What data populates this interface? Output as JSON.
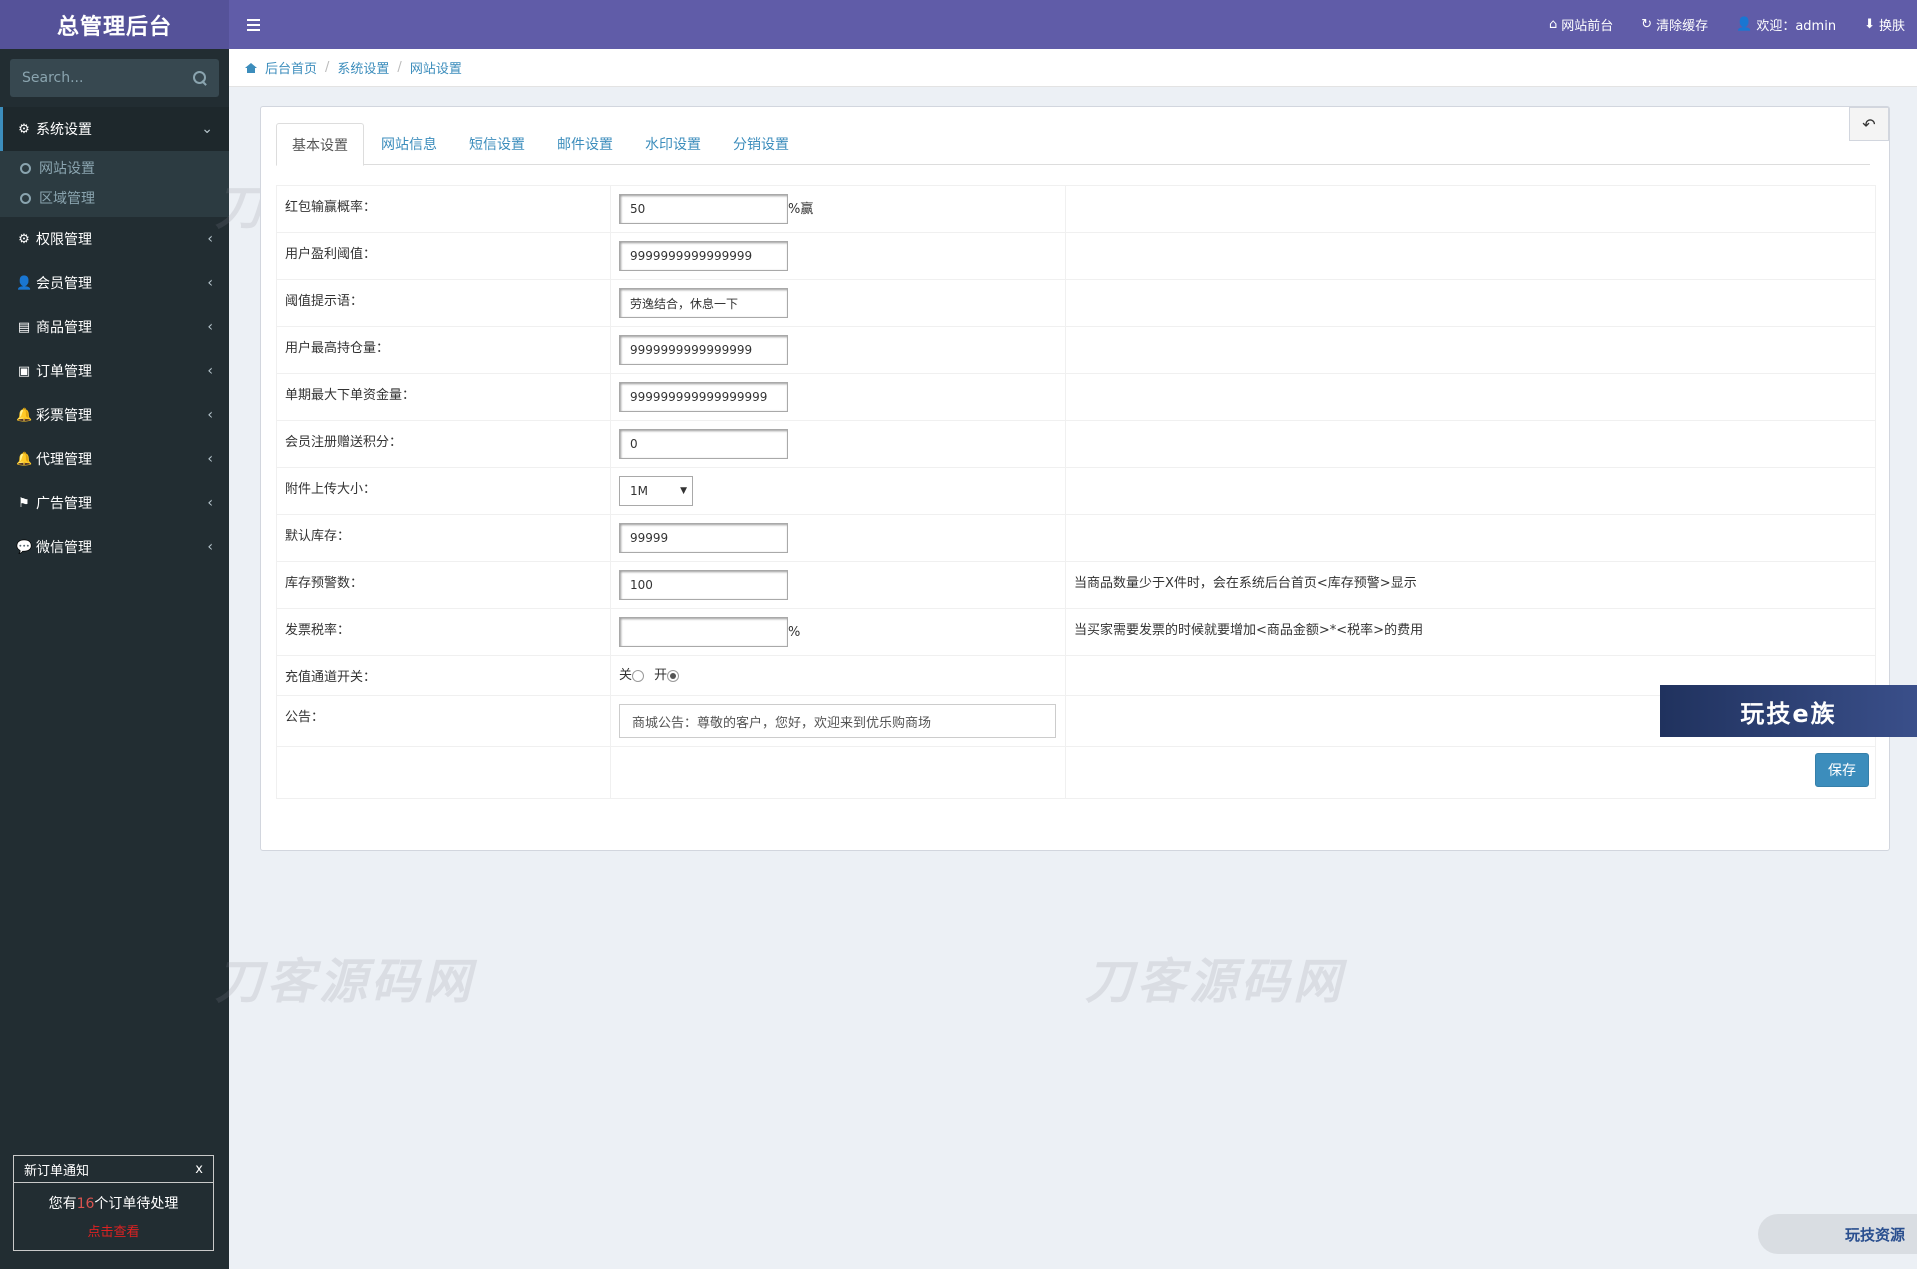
{
  "sidebar": {
    "brand": "总管理后台",
    "search_placeholder": "Search...",
    "items": [
      {
        "label": "系统设置",
        "icon": "⚙",
        "chev": "⌄"
      },
      {
        "label": "权限管理",
        "icon": "⚙",
        "chev": "‹"
      },
      {
        "label": "会员管理",
        "icon": "👤",
        "chev": "‹"
      },
      {
        "label": "商品管理",
        "icon": "▤",
        "chev": "‹"
      },
      {
        "label": "订单管理",
        "icon": "▣",
        "chev": "‹"
      },
      {
        "label": "彩票管理",
        "icon": "🔔",
        "chev": "‹"
      },
      {
        "label": "代理管理",
        "icon": "🔔",
        "chev": "‹"
      },
      {
        "label": "广告管理",
        "icon": "⚑",
        "chev": "‹"
      },
      {
        "label": "微信管理",
        "icon": "💬",
        "chev": "‹"
      }
    ],
    "submenu": [
      "网站设置",
      "区域管理"
    ],
    "notice": {
      "title": "新订单通知",
      "close": "x",
      "prefix": "您有",
      "count": "16",
      "suffix": "个订单待处理",
      "link": "点击查看"
    }
  },
  "topbar": {
    "links": [
      {
        "icon": "⌂",
        "label": "网站前台"
      },
      {
        "icon": "↻",
        "label": "清除缓存"
      },
      {
        "icon": "👤",
        "label": "欢迎：admin"
      },
      {
        "icon": "⬇",
        "label": "换肤"
      }
    ]
  },
  "breadcrumb": [
    "后台首页",
    "系统设置",
    "网站设置"
  ],
  "tabs": [
    "基本设置",
    "网站信息",
    "短信设置",
    "邮件设置",
    "水印设置",
    "分销设置"
  ],
  "back_icon": "↶",
  "form": {
    "rows": [
      {
        "label": "红包输赢概率：",
        "value": "50",
        "unit": "%赢",
        "tip": ""
      },
      {
        "label": "用户盈利阈值：",
        "value": "9999999999999999",
        "unit": "",
        "tip": ""
      },
      {
        "label": "阈值提示语：",
        "value": "劳逸结合，休息一下",
        "unit": "",
        "tip": ""
      },
      {
        "label": "用户最高持仓量：",
        "value": "9999999999999999",
        "unit": "",
        "tip": ""
      },
      {
        "label": "单期最大下单资金量：",
        "value": "999999999999999999",
        "unit": "",
        "tip": ""
      },
      {
        "label": "会员注册赠送积分：",
        "value": "0",
        "unit": "",
        "tip": ""
      },
      {
        "label": "附件上传大小：",
        "value": "1M",
        "unit": "",
        "tip": "",
        "select": true
      },
      {
        "label": "默认库存：",
        "value": "99999",
        "unit": "",
        "tip": ""
      },
      {
        "label": "库存预警数：",
        "value": "100",
        "unit": "",
        "tip": "当商品数量少于X件时，会在系统后台首页<库存预警>显示"
      },
      {
        "label": "发票税率：",
        "value": "",
        "unit": "%",
        "tip": "当买家需要发票的时候就要增加<商品金额>*<税率>的费用"
      }
    ],
    "switch": {
      "label": "充值通道开关：",
      "off": "关",
      "on": "开",
      "selected": "on"
    },
    "notice": {
      "label": "公告：",
      "value": "商城公告：尊敬的客户，您好，欢迎来到优乐购商场"
    },
    "save": "保存"
  },
  "overlays": {
    "banner": "玩技e族",
    "pill": "玩技资源",
    "watermark": "刀客源码网"
  }
}
